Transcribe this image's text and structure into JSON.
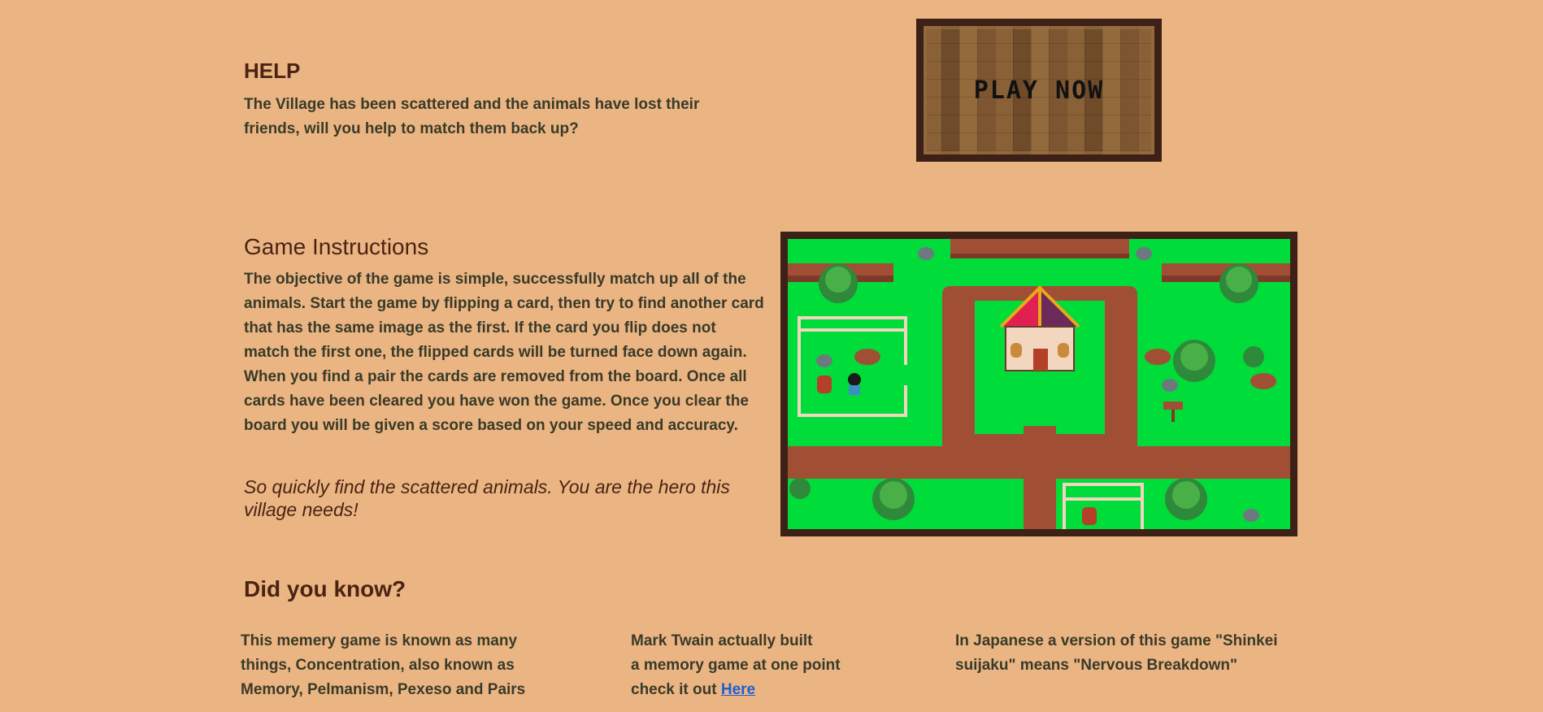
{
  "help": {
    "title": "HELP",
    "text": "The Village has been scattered and the animals have lost their friends, will you help to match them back up?"
  },
  "play_button": {
    "label": "PLAY NOW"
  },
  "instructions": {
    "title": "Game Instructions",
    "text": "The objective of the game is simple, successfully match up all of the animals. Start the game by flipping a card, then try to find another card that has the same image as the first. If the card you flip does not match the first one, the flipped cards will be turned face down again. When you find a pair the cards are removed from the board. Once all cards have been cleared you have won the game. Once you clear the board you will be given a score based on your speed and accuracy.",
    "quote": "So quickly find the scattered animals. You are the hero this village needs!"
  },
  "did_you_know": {
    "title": "Did you know?",
    "facts": [
      {
        "text": "This memery game is known as many things, Concentration, also known as Memory, Pelmanism, Pexeso and Pairs"
      },
      {
        "line1": "Mark Twain actually built",
        "line2": "a memory game at one point",
        "line3_prefix": "check it out ",
        "link_label": "Here"
      },
      {
        "text": "In Japanese a version of this game \"Shinkei suijaku\" means \"Nervous Breakdown\""
      }
    ]
  },
  "colors": {
    "background": "#eab582",
    "heading": "#4a2314",
    "frame": "#3d2116",
    "grass": "#00dc3a",
    "path": "#a14f34",
    "link": "#1f5fd6"
  }
}
